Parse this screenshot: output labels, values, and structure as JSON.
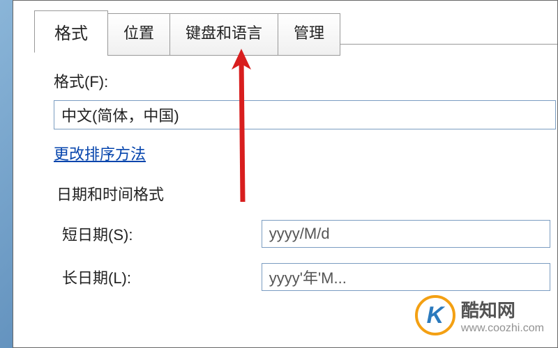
{
  "tabs": {
    "format": "格式",
    "location": "位置",
    "keyboard_lang": "键盘和语言",
    "admin": "管理"
  },
  "format": {
    "label": "格式(F):",
    "selected": "中文(简体，中国)",
    "sort_link": "更改排序方法"
  },
  "datetime": {
    "group_label": "日期和时间格式",
    "short_label": "短日期(S):",
    "short_value": "yyyy/M/d",
    "long_label": "长日期(L):",
    "long_value": "yyyy'年'M..."
  },
  "watermark": {
    "name": "酷知网",
    "url": "www.coozhi.com"
  }
}
